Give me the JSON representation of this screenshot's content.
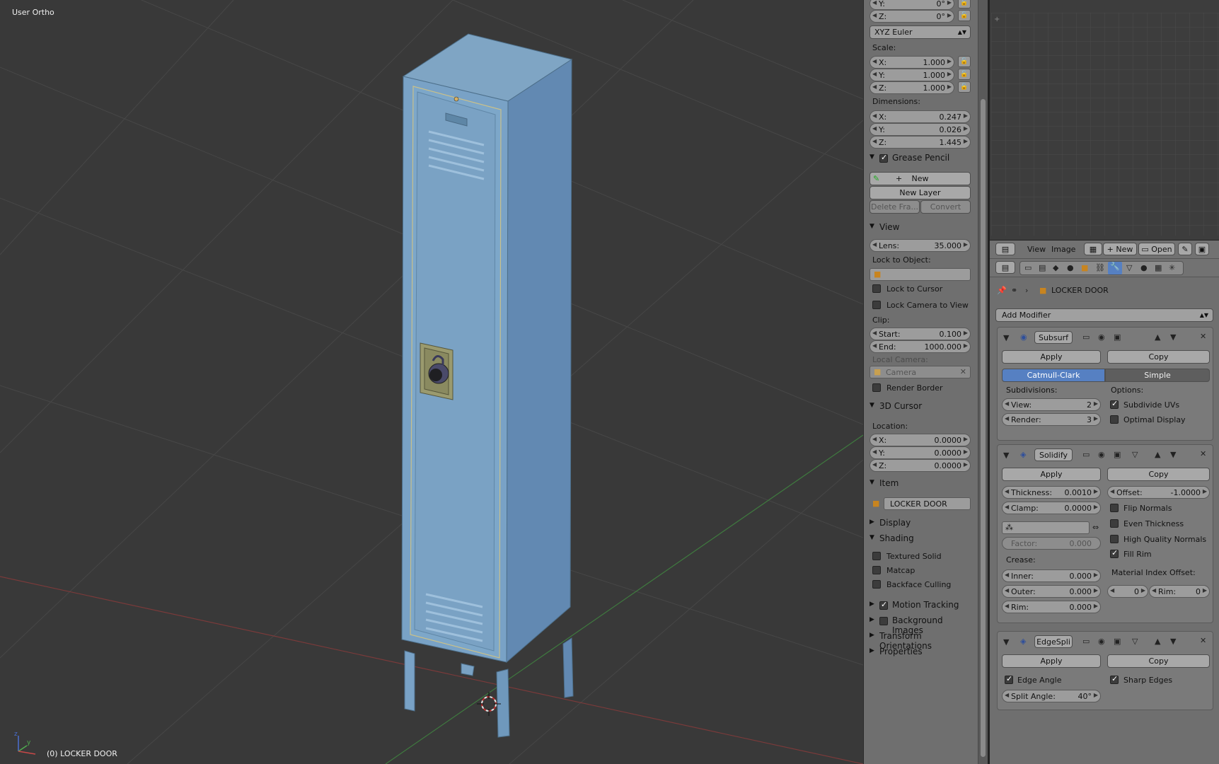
{
  "viewport": {
    "view_label": "User Ortho",
    "object_label": "(0) LOCKER DOOR"
  },
  "npanel": {
    "rotation_y": {
      "label": "Y:",
      "value": "0°"
    },
    "rotation_z": {
      "label": "Z:",
      "value": "0°"
    },
    "rotation_mode": "XYZ Euler",
    "scale_label": "Scale:",
    "scale": [
      {
        "label": "X:",
        "value": "1.000"
      },
      {
        "label": "Y:",
        "value": "1.000"
      },
      {
        "label": "Z:",
        "value": "1.000"
      }
    ],
    "dimensions_label": "Dimensions:",
    "dimensions": [
      {
        "label": "X:",
        "value": "0.247"
      },
      {
        "label": "Y:",
        "value": "0.026"
      },
      {
        "label": "Z:",
        "value": "1.445"
      }
    ],
    "grease_pencil": {
      "title": "Grease Pencil",
      "new": "New",
      "new_layer": "New Layer",
      "delete_frame": "Delete Fra...",
      "convert": "Convert"
    },
    "view": {
      "title": "View",
      "lens_label": "Lens:",
      "lens_value": "35.000",
      "lock_to_object": "Lock to Object:",
      "lock_to_cursor": "Lock to Cursor",
      "lock_camera_to_view": "Lock Camera to View",
      "clip_label": "Clip:",
      "clip_start_label": "Start:",
      "clip_start_value": "0.100",
      "clip_end_label": "End:",
      "clip_end_value": "1000.000",
      "local_camera": "Local Camera:",
      "camera": "Camera",
      "render_border": "Render Border"
    },
    "cursor": {
      "title": "3D Cursor",
      "location_label": "Location:",
      "location": [
        {
          "label": "X:",
          "value": "0.0000"
        },
        {
          "label": "Y:",
          "value": "0.0000"
        },
        {
          "label": "Z:",
          "value": "0.0000"
        }
      ]
    },
    "item": {
      "title": "Item",
      "name": "LOCKER DOOR"
    },
    "display": "Display",
    "shading": {
      "title": "Shading",
      "textured_solid": "Textured Solid",
      "matcap": "Matcap",
      "backface_culling": "Backface Culling"
    },
    "motion_tracking": "Motion Tracking",
    "background_images": "Background Images",
    "transform_orientations": "Transform Orientations",
    "properties": "Properties"
  },
  "uv_header": {
    "view": "View",
    "image": "Image",
    "new": "New",
    "open": "Open"
  },
  "properties": {
    "object_name": "LOCKER DOOR",
    "add_modifier": "Add Modifier",
    "subsurf": {
      "name": "Subsurf",
      "apply": "Apply",
      "copy": "Copy",
      "catmull_clark": "Catmull-Clark",
      "simple": "Simple",
      "subdivisions_label": "Subdivisions:",
      "options_label": "Options:",
      "view_label": "View:",
      "view_value": "2",
      "render_label": "Render:",
      "render_value": "3",
      "subdivide_uvs": "Subdivide UVs",
      "optimal_display": "Optimal Display"
    },
    "solidify": {
      "name": "Solidify",
      "apply": "Apply",
      "copy": "Copy",
      "thickness_label": "Thickness:",
      "thickness_value": "0.0010",
      "offset_label": "Offset:",
      "offset_value": "-1.0000",
      "clamp_label": "Clamp:",
      "clamp_value": "0.0000",
      "flip_normals": "Flip Normals",
      "even_thickness": "Even Thickness",
      "high_quality_normals": "High Quality Normals",
      "fill_rim": "Fill Rim",
      "factor_label": "Factor:",
      "factor_value": "0.000",
      "crease_label": "Crease:",
      "material_offset_label": "Material Index Offset:",
      "inner_label": "Inner:",
      "inner_value": "0.000",
      "outer_label": "Outer:",
      "outer_value": "0.000",
      "rim_label": "Rim:",
      "rim_value": "0.000",
      "mat_value": "0",
      "mat_rim_label": "Rim:",
      "mat_rim_value": "0"
    },
    "edgesplit": {
      "name": "EdgeSpli",
      "apply": "Apply",
      "copy": "Copy",
      "edge_angle": "Edge Angle",
      "sharp_edges": "Sharp Edges",
      "split_angle_label": "Split Angle:",
      "split_angle_value": "40°"
    }
  }
}
